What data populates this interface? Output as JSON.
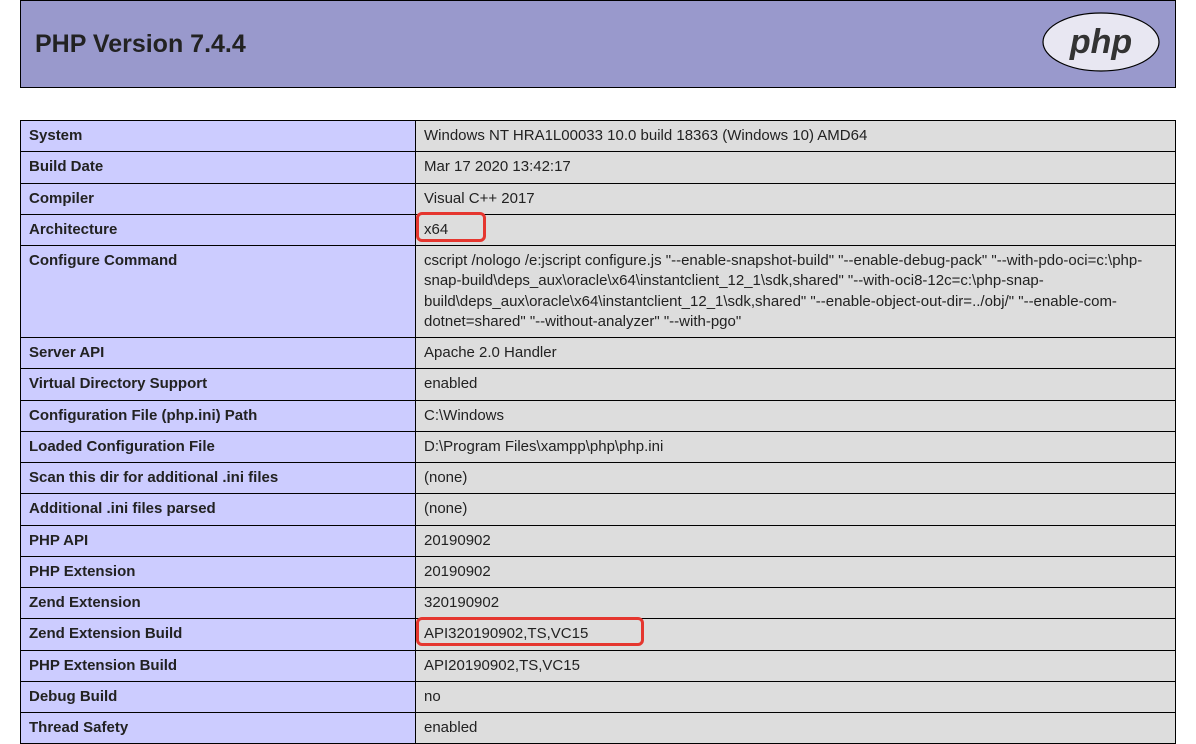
{
  "header": {
    "title": "PHP Version 7.4.4",
    "logo_text": "php"
  },
  "rows": [
    {
      "key": "System",
      "value": "Windows NT HRA1L00033 10.0 build 18363 (Windows 10) AMD64"
    },
    {
      "key": "Build Date",
      "value": "Mar 17 2020 13:42:17"
    },
    {
      "key": "Compiler",
      "value": "Visual C++ 2017"
    },
    {
      "key": "Architecture",
      "value": "x64",
      "highlight": "arch"
    },
    {
      "key": "Configure Command",
      "value": "cscript /nologo /e:jscript configure.js \"--enable-snapshot-build\" \"--enable-debug-pack\" \"--with-pdo-oci=c:\\php-snap-build\\deps_aux\\oracle\\x64\\instantclient_12_1\\sdk,shared\" \"--with-oci8-12c=c:\\php-snap-build\\deps_aux\\oracle\\x64\\instantclient_12_1\\sdk,shared\" \"--enable-object-out-dir=../obj/\" \"--enable-com-dotnet=shared\" \"--without-analyzer\" \"--with-pgo\""
    },
    {
      "key": "Server API",
      "value": "Apache 2.0 Handler"
    },
    {
      "key": "Virtual Directory Support",
      "value": "enabled"
    },
    {
      "key": "Configuration File (php.ini) Path",
      "value": "C:\\Windows"
    },
    {
      "key": "Loaded Configuration File",
      "value": "D:\\Program Files\\xampp\\php\\php.ini"
    },
    {
      "key": "Scan this dir for additional .ini files",
      "value": "(none)"
    },
    {
      "key": "Additional .ini files parsed",
      "value": "(none)"
    },
    {
      "key": "PHP API",
      "value": "20190902"
    },
    {
      "key": "PHP Extension",
      "value": "20190902"
    },
    {
      "key": "Zend Extension",
      "value": "320190902"
    },
    {
      "key": "Zend Extension Build",
      "value": "API320190902,TS,VC15",
      "highlight": "zend"
    },
    {
      "key": "PHP Extension Build",
      "value": "API20190902,TS,VC15"
    },
    {
      "key": "Debug Build",
      "value": "no"
    },
    {
      "key": "Thread Safety",
      "value": "enabled"
    }
  ]
}
